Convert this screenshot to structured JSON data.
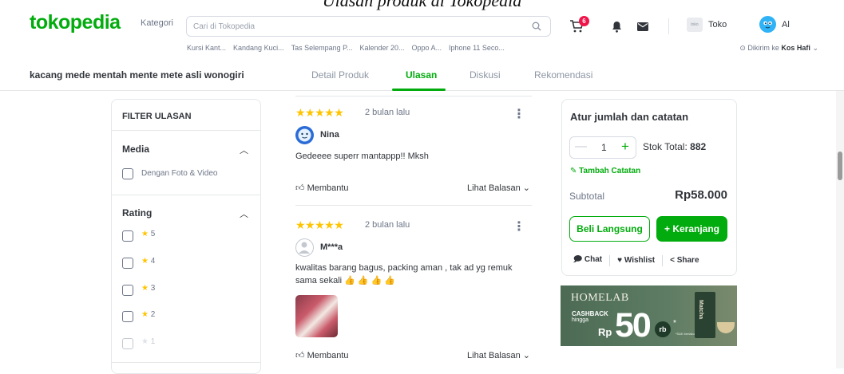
{
  "caption": "Ulasan produk di Tokopedia",
  "header": {
    "logo": "tokopedia",
    "kategori_label": "Kategori",
    "search_placeholder": "Cari di Tokopedia",
    "cart_badge": "6",
    "toko_label": "Toko",
    "shop_icon_text": "toko",
    "user_name": "Al",
    "quick_links": [
      "Kursi Kant...",
      "Kandang Kuci...",
      "Tas Selempang P...",
      "Kalender 20...",
      "Oppo A...",
      "Iphone 11 Seco..."
    ],
    "deliver_prefix": "Dikirim ke",
    "deliver_location": "Kos Hafi"
  },
  "product": {
    "name": "kacang mede mentah mente mete asli wonogiri",
    "tabs": [
      {
        "label": "Detail Produk",
        "active": false
      },
      {
        "label": "Ulasan",
        "active": true
      },
      {
        "label": "Diskusi",
        "active": false
      },
      {
        "label": "Rekomendasi",
        "active": false
      }
    ]
  },
  "filter": {
    "title": "FILTER ULASAN",
    "media_heading": "Media",
    "media_option": "Dengan Foto & Video",
    "rating_heading": "Rating",
    "ratings": [
      "5",
      "4",
      "3",
      "2",
      "1"
    ]
  },
  "reviews": [
    {
      "stars": 5,
      "time": "2 bulan lalu",
      "name": "Nina",
      "text": "Gedeeee superr mantappp!! Mksh",
      "helpful": "Membantu",
      "replies": "Lihat Balasan"
    },
    {
      "stars": 5,
      "time": "2 bulan lalu",
      "name": "M***a",
      "text": "kwalitas barang bagus, packing aman , tak ad yg remuk sama sekali",
      "emoji": "👍 👍 👍 👍",
      "helpful": "Membantu",
      "replies": "Lihat Balasan"
    }
  ],
  "cart_panel": {
    "title": "Atur jumlah dan catatan",
    "quantity": "1",
    "stock_label": "Stok Total:",
    "stock_value": "882",
    "note_link": "Tambah Catatan",
    "subtotal_label": "Subtotal",
    "subtotal_value": "Rp58.000",
    "buy_now": "Beli Langsung",
    "add_to_cart": "+ Keranjang",
    "chat": "Chat",
    "wishlist": "Wishlist",
    "share": "Share"
  },
  "banner": {
    "brand": "HOMELAB",
    "cashback": "CASHBACK",
    "hingga": "hingga",
    "rp": "Rp",
    "amount": "50",
    "unit": "rb",
    "asterisk": "*",
    "fine_print": "*S&K berlaku",
    "pack_label": "Matcha"
  },
  "colors": {
    "brand_green": "#03ac0e",
    "star": "#ffc400",
    "badge": "#ef144a"
  }
}
